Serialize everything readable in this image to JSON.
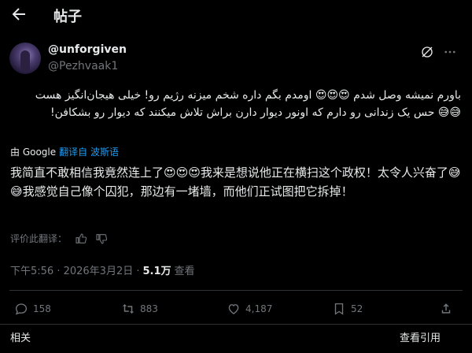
{
  "header": {
    "title": "帖子",
    "back_icon": "arrow-left-icon"
  },
  "author": {
    "display_name": "@unforgiven",
    "handle": "@Pezhvaak1"
  },
  "post": {
    "original_text": "باورم نمیشه وصل شدم 😍😍😍 اومدم بگم داره شخم میزنه رژیم رو! خیلی هیجان‌انگیز هست 😅😅 حس یک زندانی رو دارم که اونور دیوار دارن براش تلاش میکنند که دیوار رو بشکافن!",
    "translated_by": "由 Google",
    "translated_from": "翻译自 波斯语",
    "translated_text": "我简直不敢相信我竟然连上了😍😍😍我来是想说他正在横扫这个政权！太令人兴奋了😅😅我感觉自己像个囚犯，那边有一堵墙，而他们正试图把它拆掉！",
    "rate_translation": "评价此翻译："
  },
  "meta": {
    "timestamp": "下午5:56 · 2026年3月2日 · ",
    "views_count": "5.1万",
    "views_label": "查看"
  },
  "actions": {
    "replies": "158",
    "reposts": "883",
    "likes": "4,187",
    "bookmarks": "52"
  },
  "footer": {
    "related": "相关",
    "view_quotes": "查看引用"
  },
  "colors": {
    "accent": "#1d9bf0",
    "text": "#e7e9ea",
    "muted": "#71767b",
    "background": "#000000"
  }
}
